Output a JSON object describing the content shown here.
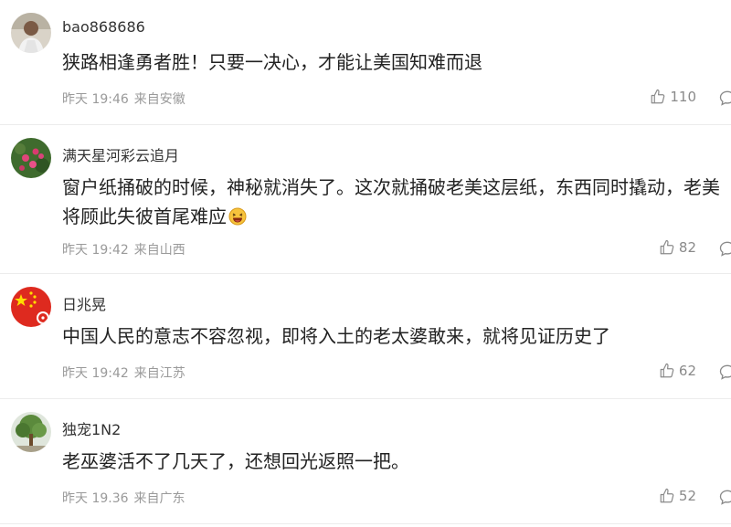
{
  "comments": [
    {
      "username": "bao868686",
      "text": "狭路相逢勇者胜！只要一决心，才能让美国知难而退",
      "time": "昨天 19:46",
      "location": "来自安徽",
      "likes": "110",
      "avatar_icon": "person-photo-avatar"
    },
    {
      "username": "满天星河彩云追月",
      "text": "窗户纸捅破的时候，神秘就消失了。这次就捅破老美这层纸，东西同时撬动，老美将顾此失彼首尾难应",
      "time": "昨天 19:42",
      "location": "来自山西",
      "likes": "82",
      "avatar_icon": "flower-photo-avatar",
      "emoji": "laughing-emoji"
    },
    {
      "username": "日兆晃",
      "text": "中国人民的意志不容忽视，即将入土的老太婆敢来，就将见证历史了",
      "time": "昨天 19:42",
      "location": "来自江苏",
      "likes": "62",
      "avatar_icon": "flag-avatar"
    },
    {
      "username": "独宠1N2",
      "text": "老巫婆活不了几天了，还想回光返照一把。",
      "time": "昨天 19.36",
      "location": "来自广东",
      "likes": "52",
      "avatar_icon": "tree-photo-avatar"
    }
  ],
  "icons": {
    "like": "thumbs-up-icon",
    "reply": "comment-bubble-icon"
  },
  "colors": {
    "text": "#222222",
    "username": "#333333",
    "meta": "#9a9a9a",
    "divider": "#ececec"
  }
}
